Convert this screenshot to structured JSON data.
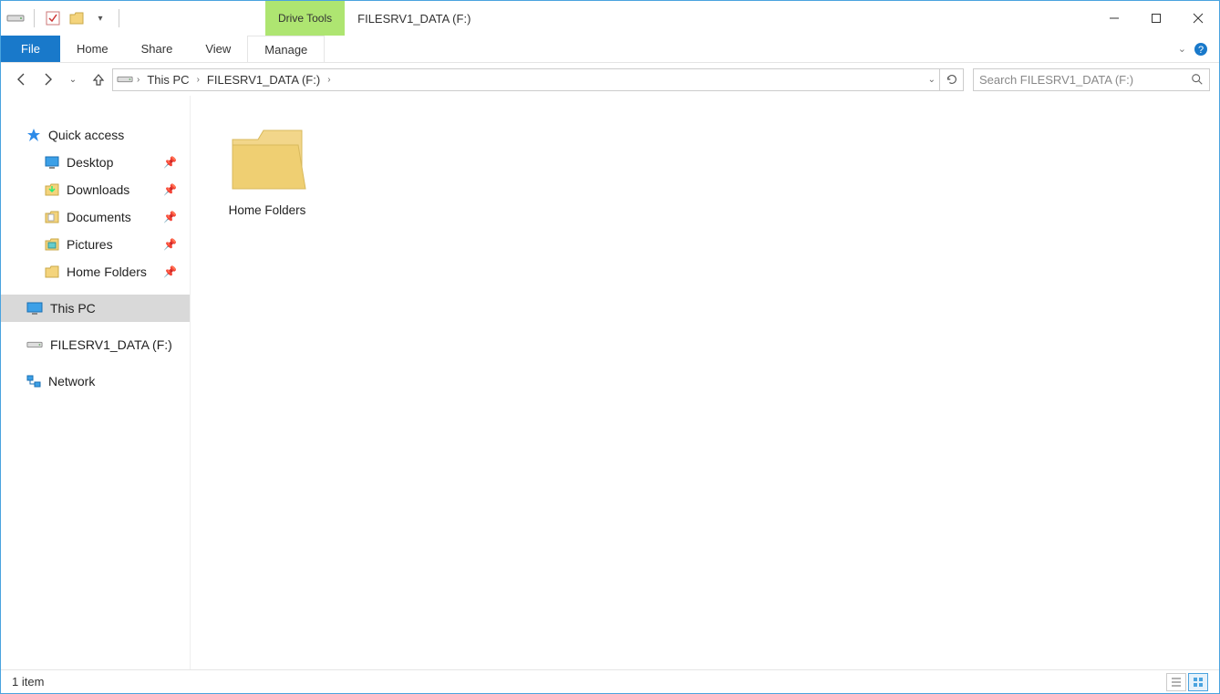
{
  "titlebar": {
    "contextual_tab": "Drive Tools",
    "title": "FILESRV1_DATA (F:)"
  },
  "ribbon": {
    "file": "File",
    "home": "Home",
    "share": "Share",
    "view": "View",
    "manage": "Manage"
  },
  "breadcrumb": {
    "root": "This PC",
    "current": "FILESRV1_DATA (F:)"
  },
  "search": {
    "placeholder": "Search FILESRV1_DATA (F:)"
  },
  "sidebar": {
    "quick_access": "Quick access",
    "items": [
      {
        "label": "Desktop"
      },
      {
        "label": "Downloads"
      },
      {
        "label": "Documents"
      },
      {
        "label": "Pictures"
      },
      {
        "label": "Home Folders"
      }
    ],
    "this_pc": "This PC",
    "drive": "FILESRV1_DATA (F:)",
    "network": "Network"
  },
  "content": {
    "items": [
      {
        "label": "Home Folders"
      }
    ]
  },
  "statusbar": {
    "count": "1 item"
  }
}
